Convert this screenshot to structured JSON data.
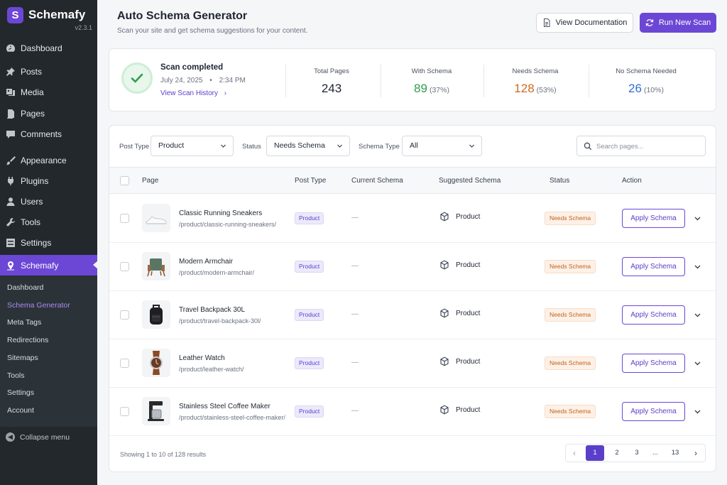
{
  "brand": {
    "name": "Schemafy",
    "logo_letter": "S",
    "version": "v2.3.1"
  },
  "sidebar": {
    "items": [
      {
        "label": "Dashboard",
        "icon": "dashboard-icon"
      },
      {
        "label": "Posts",
        "icon": "pin-icon"
      },
      {
        "label": "Media",
        "icon": "media-icon"
      },
      {
        "label": "Pages",
        "icon": "pages-icon"
      },
      {
        "label": "Comments",
        "icon": "comment-icon"
      },
      {
        "label": "Appearance",
        "icon": "brush-icon"
      },
      {
        "label": "Plugins",
        "icon": "plug-icon"
      },
      {
        "label": "Users",
        "icon": "user-icon"
      },
      {
        "label": "Tools",
        "icon": "wrench-icon"
      },
      {
        "label": "Settings",
        "icon": "settings-icon"
      },
      {
        "label": "Schemafy",
        "icon": "schemafy-icon",
        "active": true
      }
    ],
    "submenu": [
      "Dashboard",
      "Schema Generator",
      "Meta Tags",
      "Redirections",
      "Sitemaps",
      "Tools",
      "Settings",
      "Account"
    ],
    "submenu_current": "Schema Generator",
    "collapse_label": "Collapse menu"
  },
  "header": {
    "title": "Auto Schema Generator",
    "subtitle": "Scan your site and get schema suggestions for your content.",
    "doc_button": "View Documentation",
    "scan_button": "Run New Scan"
  },
  "summary": {
    "title": "Scan completed",
    "date": "July 24, 2025",
    "time": "2:34 PM",
    "history_link": "View Scan History",
    "stats": [
      {
        "label": "Total Pages",
        "value": "243",
        "pct": "",
        "color": "#1f2533"
      },
      {
        "label": "With Schema",
        "value": "89",
        "pct": "(37%)",
        "color": "#2e9e4a"
      },
      {
        "label": "Needs Schema",
        "value": "128",
        "pct": "(53%)",
        "color": "#d2691e"
      },
      {
        "label": "No Schema Needed",
        "value": "26",
        "pct": "(10%)",
        "color": "#2f6fd6"
      }
    ]
  },
  "filters": {
    "post_type_label": "Post Type",
    "post_type_value": "Product",
    "status_label": "Status",
    "status_value": "Needs Schema",
    "schema_type_label": "Schema Type",
    "schema_type_value": "All",
    "search_placeholder": "Search pages..."
  },
  "table": {
    "headers": {
      "page": "Page",
      "post_type": "Post Type",
      "current": "Current Schema",
      "suggested": "Suggested Schema",
      "status": "Status",
      "action": "Action"
    },
    "rows": [
      {
        "title": "Classic Running Sneakers",
        "url": "/product/classic-running-sneakers/",
        "type": "Product",
        "current": "—",
        "suggested": "Product",
        "status": "Needs Schema",
        "action": "Apply Schema",
        "thumb": "sneaker"
      },
      {
        "title": "Modern Armchair",
        "url": "/product/modern-armchair/",
        "type": "Product",
        "current": "—",
        "suggested": "Product",
        "status": "Needs Schema",
        "action": "Apply Schema",
        "thumb": "chair"
      },
      {
        "title": "Travel Backpack 30L",
        "url": "/product/travel-backpack-30l/",
        "type": "Product",
        "current": "—",
        "suggested": "Product",
        "status": "Needs Schema",
        "action": "Apply Schema",
        "thumb": "backpack"
      },
      {
        "title": "Leather Watch",
        "url": "/product/leather-watch/",
        "type": "Product",
        "current": "—",
        "suggested": "Product",
        "status": "Needs Schema",
        "action": "Apply Schema",
        "thumb": "watch"
      },
      {
        "title": "Stainless Steel Coffee Maker",
        "url": "/product/stainless-steel-coffee-maker/",
        "type": "Product",
        "current": "—",
        "suggested": "Product",
        "status": "Needs Schema",
        "action": "Apply Schema",
        "thumb": "coffee"
      }
    ]
  },
  "footer": {
    "results_text": "Showing 1 to 10 of 128 results",
    "pages": [
      "1",
      "2",
      "3",
      "...",
      "13"
    ],
    "current_page": "1"
  },
  "colors": {
    "accent": "#6c47d6",
    "sidebar": "#23282d",
    "success": "#2e9e4a",
    "warning": "#d2691e",
    "info": "#2f6fd6"
  }
}
